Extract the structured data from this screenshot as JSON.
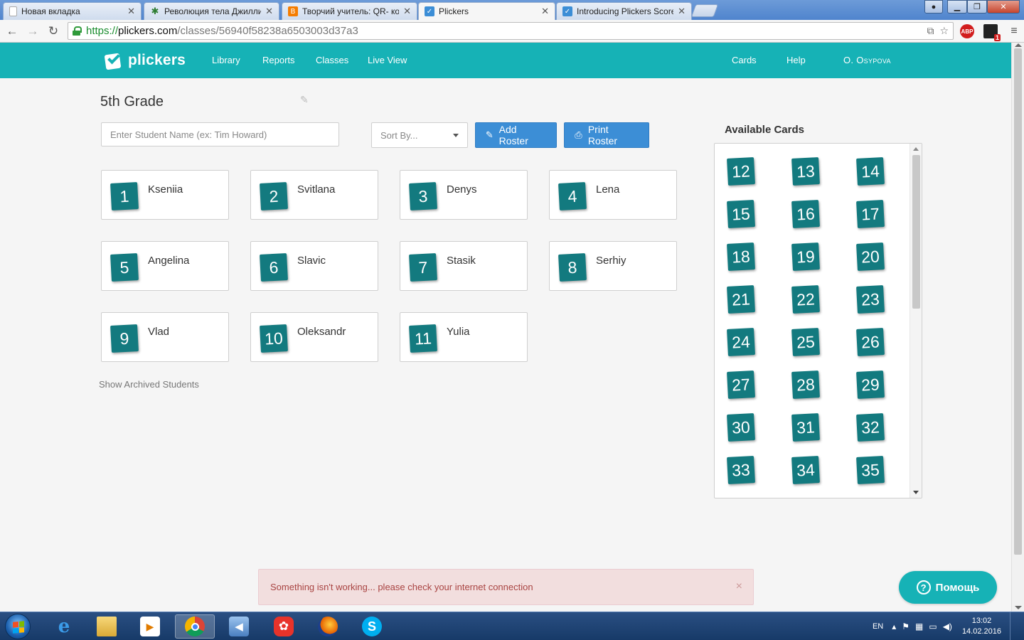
{
  "browser": {
    "tabs": [
      {
        "title": "Новая вкладка",
        "active": false,
        "favicon": "blank-page-icon"
      },
      {
        "title": "Революция тела Джиллиан",
        "active": false,
        "favicon": "bug-icon"
      },
      {
        "title": "Творчий учитель: QR- код",
        "active": false,
        "favicon": "blogger-icon"
      },
      {
        "title": "Plickers",
        "active": true,
        "favicon": "plickers-icon"
      },
      {
        "title": "Introducing Plickers Scorecard",
        "active": false,
        "favicon": "plickers-icon"
      }
    ],
    "url": {
      "scheme": "https://",
      "host": "plickers.com",
      "path": "/classes/56940f58238a6503003d37a3"
    },
    "extensions": [
      "translate-icon",
      "star-icon",
      "abp-icon",
      "cast-icon",
      "menu-icon"
    ],
    "abp_label": "ABP",
    "ext_badge": "1"
  },
  "navbar": {
    "brand": "plickers",
    "links": [
      "Library",
      "Reports",
      "Classes",
      "Live View"
    ],
    "right_links": [
      "Cards",
      "Help"
    ],
    "user": "O. Osypova"
  },
  "class": {
    "title": "5th Grade",
    "student_placeholder": "Enter Student Name (ex: Tim Howard)",
    "sort_placeholder": "Sort By...",
    "add_roster_label": "Add Roster",
    "print_roster_label": "Print Roster",
    "archived_label": "Show Archived Students"
  },
  "students": [
    {
      "card": "1",
      "name": "Kseniia"
    },
    {
      "card": "2",
      "name": "Svitlana"
    },
    {
      "card": "3",
      "name": "Denys"
    },
    {
      "card": "4",
      "name": "Lena"
    },
    {
      "card": "5",
      "name": "Angelina"
    },
    {
      "card": "6",
      "name": "Slavic"
    },
    {
      "card": "7",
      "name": "Stasik"
    },
    {
      "card": "8",
      "name": "Serhiy"
    },
    {
      "card": "9",
      "name": "Vlad"
    },
    {
      "card": "10",
      "name": "Oleksandr"
    },
    {
      "card": "11",
      "name": "Yulia"
    }
  ],
  "available_cards": {
    "title": "Available Cards",
    "cards": [
      "12",
      "13",
      "14",
      "15",
      "16",
      "17",
      "18",
      "19",
      "20",
      "21",
      "22",
      "23",
      "24",
      "25",
      "26",
      "27",
      "28",
      "29",
      "30",
      "31",
      "32",
      "33",
      "34",
      "35"
    ]
  },
  "alert": {
    "message": "Something isn't working... please check your internet connection",
    "close": "×"
  },
  "help_button": {
    "label": "Помощь",
    "icon": "?"
  },
  "taskbar": {
    "apps": [
      "internet-explorer-icon",
      "file-explorer-icon",
      "media-player-icon",
      "chrome-icon",
      "speaker-app-icon",
      "mail-ru-agent-icon",
      "firefox-icon",
      "skype-icon"
    ],
    "active_app": "chrome-icon",
    "language": "EN",
    "time": "13:02",
    "date": "14.02.2016"
  },
  "colors": {
    "brand_teal": "#16b2b6",
    "card_teal": "#137a7f",
    "button_blue": "#3c8ed6",
    "alert_bg": "#f2dede",
    "alert_text": "#a94442"
  }
}
